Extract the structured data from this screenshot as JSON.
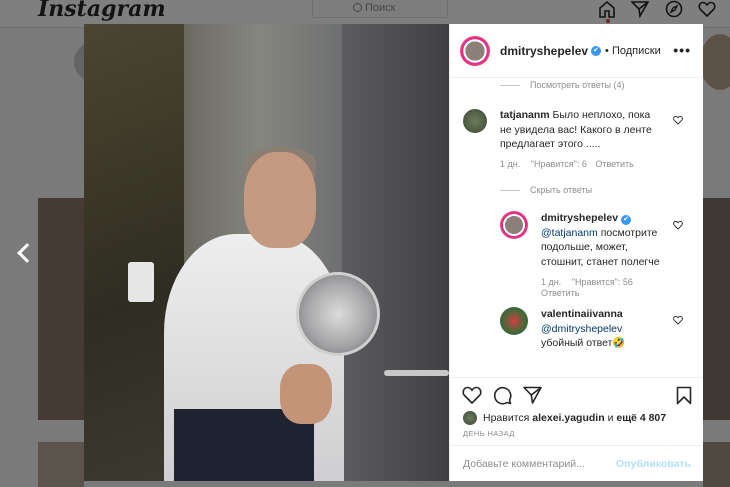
{
  "topbar": {
    "logo": "Instagram",
    "search_placeholder": "Поиск"
  },
  "post": {
    "author": "dmitryshepelev",
    "follow_label": "• Подписки",
    "more_label": "•••"
  },
  "comments": {
    "view_replies_top": "Посмотреть ответы (4)",
    "hide_replies": "Скрыть ответы",
    "items": [
      {
        "user": "tatjananm",
        "text": "Было неплохо, пока не увидела вас! Какого в ленте предлагает этого .....",
        "line1": "Было неплохо, пока",
        "line2": "не увидела вас! Какого в ленте",
        "line3": "предлагает этого .....",
        "time": "1 дн.",
        "likes": "\"Нравится\": 6",
        "reply": "Ответить"
      },
      {
        "user": "dmitryshepelev",
        "mention": "@tatjananm",
        "line1": " посмотрите",
        "line2": "подольше, может,",
        "line3": "стошнит, станет полегче",
        "time": "1 дн.",
        "likes": "\"Нравится\": 56",
        "reply": "Ответить"
      },
      {
        "user": "valentinaiivanna",
        "mention": "@dmitryshepelev",
        "line1": "убойный ответ🤣"
      }
    ]
  },
  "likes": {
    "prefix": "Нравится",
    "user": "alexei.yagudin",
    "middle": "и",
    "more": "ещё 4 807"
  },
  "date_label": "ДЕНЬ НАЗАД",
  "add_comment": {
    "placeholder": "Добавьте комментарий...",
    "publish_label": "Опубликовать"
  },
  "colors": {
    "link_blue": "#3897f0",
    "publish_disabled": "#b2dffc",
    "mention": "#00376b",
    "muted": "#8e8e8e"
  }
}
